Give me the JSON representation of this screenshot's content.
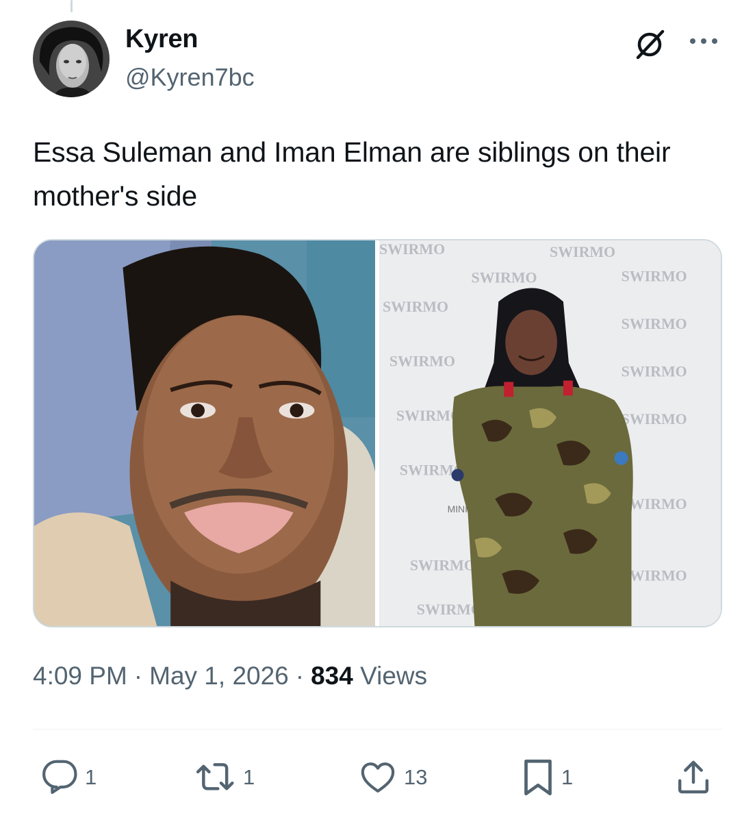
{
  "tweet": {
    "author": {
      "display_name": "Kyren",
      "handle": "@Kyren7bc"
    },
    "text": "Essa Suleman and Iman Elman are siblings on their mother's side",
    "media_watermark": "SWIRMO",
    "timestamp": {
      "time": "4:09 PM",
      "separator": "·",
      "date": "May 1, 2026",
      "views_count": "834",
      "views_label": "Views"
    },
    "actions": {
      "replies": "1",
      "reposts": "1",
      "likes": "13",
      "bookmarks": "1"
    }
  },
  "colors": {
    "text_primary": "#0f1419",
    "text_secondary": "#536471",
    "border": "#cfd9de",
    "divider": "#eff3f4"
  },
  "icons": {
    "grok": "grok-icon",
    "more": "more-icon",
    "reply": "reply-icon",
    "repost": "repost-icon",
    "like": "heart-icon",
    "bookmark": "bookmark-icon",
    "share": "share-icon"
  }
}
